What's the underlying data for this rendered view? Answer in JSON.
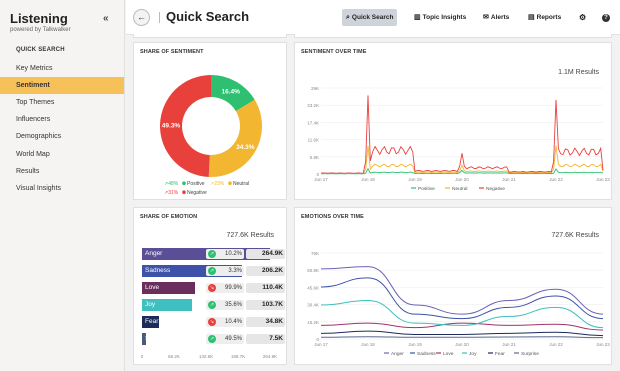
{
  "app": {
    "title": "Listening",
    "subtitle": "powered by Talkwalker",
    "collapse_glyph": "«"
  },
  "sidebar": {
    "section": "QUICK SEARCH",
    "items": [
      {
        "label": "Key Metrics"
      },
      {
        "label": "Sentiment",
        "active": true
      },
      {
        "label": "Top Themes"
      },
      {
        "label": "Influencers"
      },
      {
        "label": "Demographics"
      },
      {
        "label": "World Map"
      },
      {
        "label": "Results"
      },
      {
        "label": "Visual Insights"
      }
    ]
  },
  "topbar": {
    "back_glyph": "←",
    "title": "Quick Search",
    "buttons": [
      {
        "label": "Quick Search",
        "icon": "search-icon",
        "glyph": "⌕",
        "active": true
      },
      {
        "label": "Topic Insights",
        "icon": "bar-chart-icon",
        "glyph": "▥"
      },
      {
        "label": "Alerts",
        "icon": "mail-icon",
        "glyph": "✉"
      },
      {
        "label": "Reports",
        "icon": "document-icon",
        "glyph": "▤"
      },
      {
        "label": "",
        "icon": "gear-icon",
        "glyph": "⚙"
      },
      {
        "label": "",
        "icon": "help-icon",
        "glyph": "?"
      }
    ]
  },
  "share_of_sentiment": {
    "title": "SHARE OF SENTIMENT",
    "chart_data": {
      "type": "pie",
      "categories": [
        "Positive",
        "Neutral",
        "Negative"
      ],
      "values": [
        16.4,
        34.3,
        49.3
      ],
      "labels": [
        "16.4%",
        "34.3%",
        "49.3%"
      ],
      "colors": [
        "#2fbf71",
        "#f2b630",
        "#e8413c"
      ],
      "legend": [
        {
          "trend": "48%",
          "name": "Positive"
        },
        {
          "trend": "23%",
          "name": "Neutral"
        },
        {
          "trend": "31%",
          "name": "Negative"
        }
      ]
    }
  },
  "sentiment_over_time": {
    "title": "SENTIMENT OVER TIME",
    "results": "1.1M Results",
    "chart_data": {
      "type": "line",
      "x": [
        "Jun 17",
        "Jun 18",
        "Jun 19",
        "Jun 20",
        "Jun 21",
        "Jun 22",
        "Jun 23"
      ],
      "y_ticks": [
        "29K",
        "23.2K",
        "17.4K",
        "11.6K",
        "5.8K",
        "0"
      ],
      "series": [
        {
          "name": "Positive",
          "color": "#2fbf71",
          "values": [
            300,
            1800,
            700,
            1200,
            600,
            1700,
            1000
          ]
        },
        {
          "name": "Neutral",
          "color": "#f2b630",
          "values": [
            600,
            9500,
            2000,
            3000,
            1500,
            9500,
            3000
          ]
        },
        {
          "name": "Negative",
          "color": "#e8413c",
          "values": [
            1000,
            26500,
            3500,
            7000,
            2500,
            25000,
            4000
          ]
        }
      ]
    }
  },
  "share_of_emotion": {
    "title": "SHARE OF EMOTION",
    "results": "727.6K Results",
    "chart_data": {
      "type": "bar",
      "categories": [
        "Anger",
        "Sadness",
        "Love",
        "Joy",
        "Fear",
        "Surprise"
      ],
      "values": [
        264900,
        206200,
        110400,
        103700,
        34800,
        7500
      ],
      "value_labels": [
        "264.9K",
        "206.2K",
        "110.4K",
        "103.7K",
        "34.8K",
        "7.5K"
      ],
      "trends": [
        "10.2%",
        "3.3%",
        "99.9%",
        "35.6%",
        "10.4%",
        "49.5%"
      ],
      "trend_up": [
        true,
        true,
        false,
        true,
        false,
        true
      ],
      "colors": [
        "#5a4e96",
        "#3d52a8",
        "#6b2d5c",
        "#3fbfbf",
        "#1d2a5c",
        "#4a5a7a"
      ],
      "x_ticks": [
        "0",
        "66.2K",
        "132.5K",
        "198.7K",
        "264.9K"
      ],
      "xlim": [
        0,
        264900
      ]
    }
  },
  "emotions_over_time": {
    "title": "EMOTIONS OVER TIME",
    "results": "727.6K Results",
    "chart_data": {
      "type": "line",
      "x": [
        "Jun 17",
        "Jun 18",
        "Jun 19",
        "Jun 20",
        "Jun 21",
        "Jun 22",
        "Jun 23"
      ],
      "y_ticks": [
        "76K",
        "60.8K",
        "45.6K",
        "30.4K",
        "15.2K",
        "0"
      ],
      "series": [
        {
          "name": "Anger",
          "color": "#6b63b5",
          "values": [
            62000,
            64000,
            30000,
            22000,
            34000,
            44000,
            22000
          ]
        },
        {
          "name": "Sadness",
          "color": "#3d52a8",
          "values": [
            46000,
            54000,
            22000,
            18000,
            28000,
            38000,
            18000
          ]
        },
        {
          "name": "Love",
          "color": "#a0336b",
          "values": [
            12000,
            14000,
            10000,
            14000,
            12000,
            13000,
            8000
          ]
        },
        {
          "name": "Joy",
          "color": "#3fbfbf",
          "values": [
            30000,
            34000,
            14000,
            12000,
            20000,
            28000,
            10000
          ]
        },
        {
          "name": "Fear",
          "color": "#1d2a5c",
          "values": [
            5000,
            7000,
            4000,
            4000,
            5000,
            6000,
            3000
          ]
        },
        {
          "name": "Surprise",
          "color": "#5a6a8a",
          "values": [
            1500,
            2000,
            1500,
            1500,
            1800,
            2000,
            1200
          ]
        }
      ]
    }
  }
}
